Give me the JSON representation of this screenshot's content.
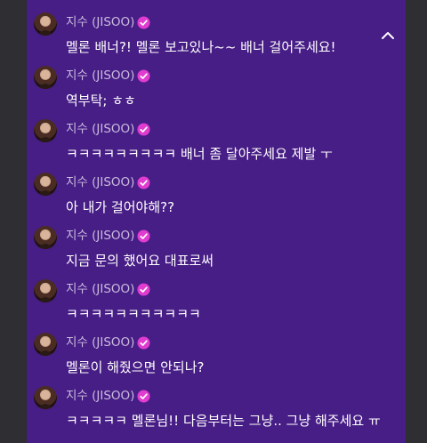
{
  "messages": [
    {
      "name": "지수 (JISOO)",
      "text": "멜론 배너?! 멜론 보고있나~~ 배너 걸어주세요!"
    },
    {
      "name": "지수 (JISOO)",
      "text": "역부탁; ㅎㅎ"
    },
    {
      "name": "지수 (JISOO)",
      "text": "ㅋㅋㅋㅋㅋㅋㅋㅋㅋ 배너 좀 달아주세요 제발 ㅜ"
    },
    {
      "name": "지수 (JISOO)",
      "text": "아 내가 걸어야해??"
    },
    {
      "name": "지수 (JISOO)",
      "text": "지금 문의 했어요 대표로써"
    },
    {
      "name": "지수 (JISOO)",
      "text": "ㅋㅋㅋㅋㅋㅋㅋㅋㅋㅋㅋ"
    },
    {
      "name": "지수 (JISOO)",
      "text": "멜론이 해줬으면 안되나?"
    },
    {
      "name": "지수 (JISOO)",
      "text": "ㅋㅋㅋㅋㅋ 멜론님!! 다음부터는 그냥.. 그냥 해주세요 ㅠ"
    }
  ],
  "icons": {
    "verified": "verified-badge-icon",
    "collapse": "chevron-up-icon"
  },
  "colors": {
    "panel": "#471d86",
    "name": "#c9bddd",
    "badge": "#e03cd0",
    "text": "#ffffff"
  }
}
